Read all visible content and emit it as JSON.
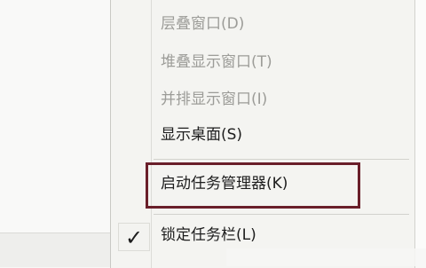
{
  "menu": {
    "items": [
      {
        "label": "层叠窗口(D)",
        "state": "disabled"
      },
      {
        "label": "堆叠显示窗口(T)",
        "state": "disabled"
      },
      {
        "label": "并排显示窗口(I)",
        "state": "disabled"
      },
      {
        "label": "显示桌面(S)",
        "state": "enabled"
      },
      {
        "label": "启动任务管理器(K)",
        "state": "enabled",
        "highlighted": true
      },
      {
        "label": "锁定任务栏(L)",
        "state": "enabled",
        "checked": true
      }
    ],
    "check_glyph": "✓"
  },
  "colors": {
    "highlight_border": "#6a1f2a",
    "disabled_text": "#9c9c98",
    "enabled_text": "#1d1d1d",
    "menu_bg": "#f4f4f1"
  },
  "icons": {
    "checkmark": "check-icon"
  }
}
